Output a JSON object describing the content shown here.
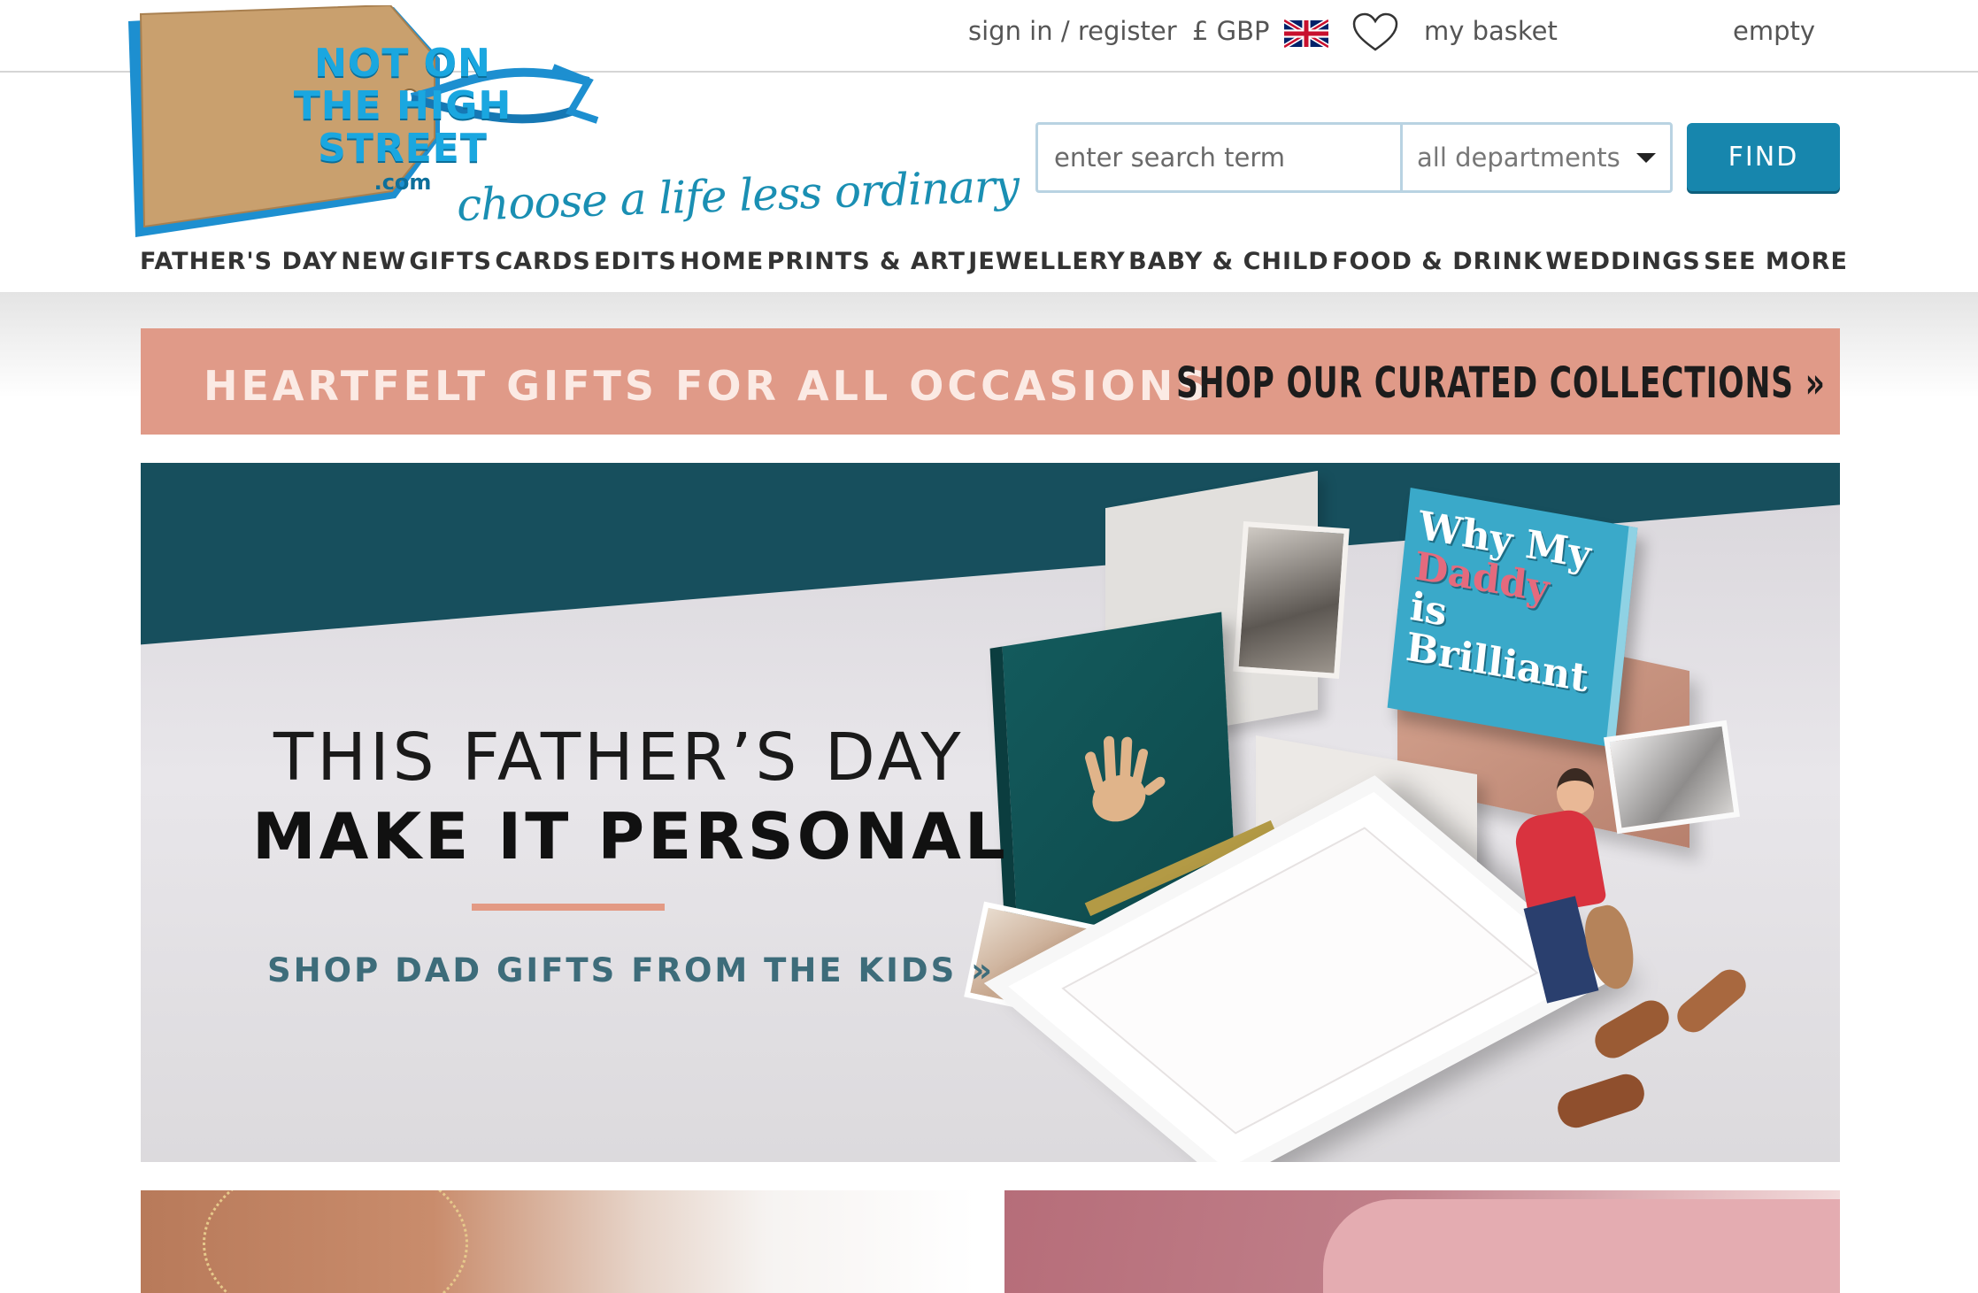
{
  "header": {
    "sign_in": "sign in / register",
    "currency": "£ GBP",
    "flag_icon": "uk-flag-icon",
    "wishlist_icon": "heart-icon",
    "basket": "my basket",
    "basket_status": "empty"
  },
  "logo": {
    "line1": "NOT ON",
    "line2": "THE HIGH",
    "line3": "STREET",
    "suffix": ".com",
    "tagline": "choose a life less ordinary"
  },
  "search": {
    "placeholder": "enter search term",
    "department": "all departments",
    "button": "FIND"
  },
  "nav": [
    "FATHER'S DAY",
    "NEW",
    "GIFTS",
    "CARDS",
    "EDITS",
    "HOME",
    "PRINTS & ART",
    "JEWELLERY",
    "BABY & CHILD",
    "FOOD & DRINK",
    "WEDDINGS",
    "SEE MORE"
  ],
  "promo": {
    "left": "HEARTFELT GIFTS FOR ALL OCCASIONS",
    "right": "SHOP OUR CURATED COLLECTIONS »"
  },
  "hero": {
    "title1": "THIS FATHER’S DAY",
    "title2": "MAKE IT PERSONAL",
    "cta": "SHOP DAD GIFTS FROM THE KIDS »",
    "book_title": {
      "w1": "Why My",
      "w2": "Daddy",
      "w3": "is Brilliant"
    }
  },
  "colors": {
    "brand_blue": "#1786ad",
    "promo_pink": "#e09a88",
    "hero_teal": "#174f5d",
    "accent_rule": "#e39a84"
  }
}
